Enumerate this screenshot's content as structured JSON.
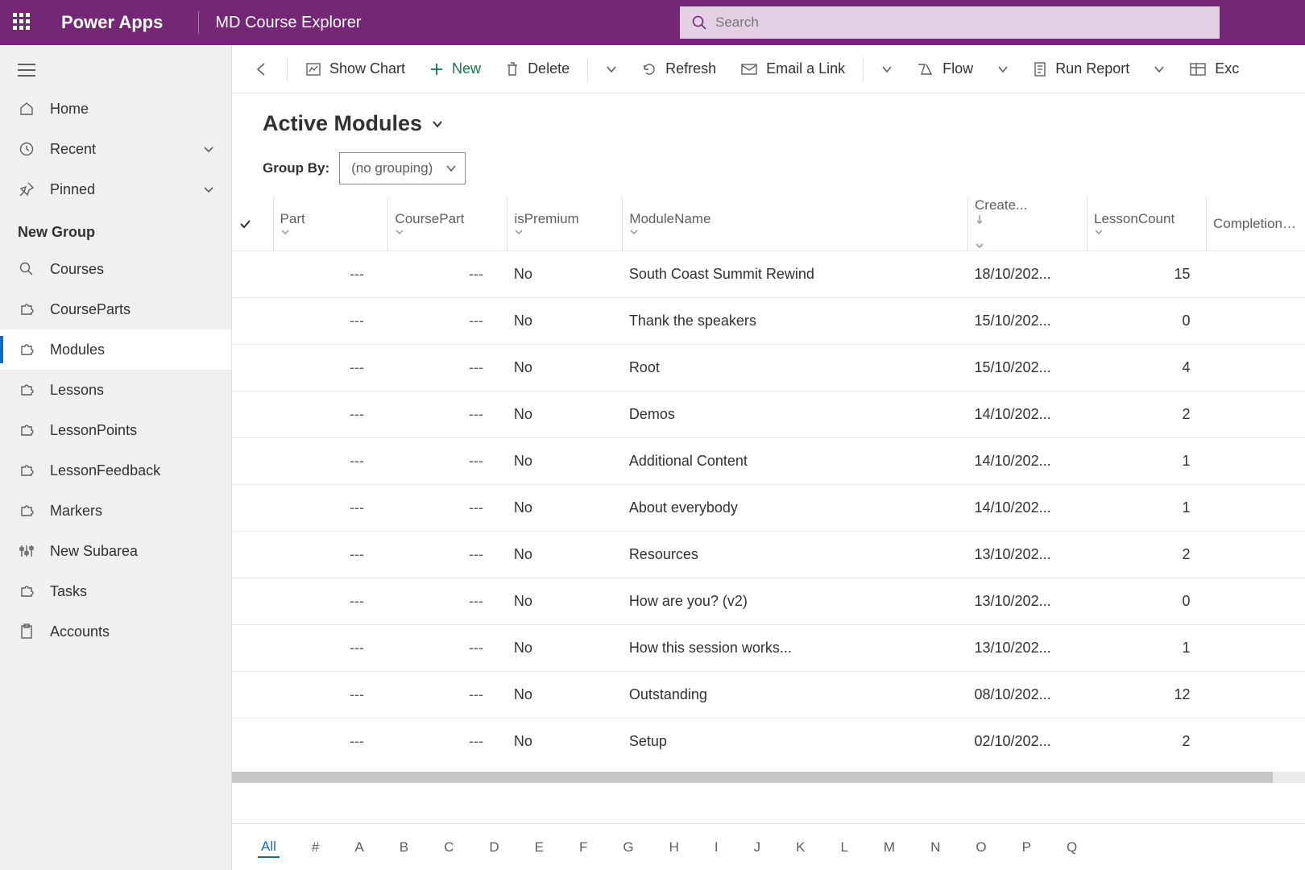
{
  "header": {
    "brand": "Power Apps",
    "app_name": "MD Course Explorer",
    "search_placeholder": "Search"
  },
  "sidebar": {
    "top": [
      {
        "label": "Home"
      },
      {
        "label": "Recent"
      },
      {
        "label": "Pinned"
      }
    ],
    "group_label": "New Group",
    "items": [
      {
        "label": "Courses"
      },
      {
        "label": "CourseParts"
      },
      {
        "label": "Modules"
      },
      {
        "label": "Lessons"
      },
      {
        "label": "LessonPoints"
      },
      {
        "label": "LessonFeedback"
      },
      {
        "label": "Markers"
      },
      {
        "label": "New Subarea"
      },
      {
        "label": "Tasks"
      },
      {
        "label": "Accounts"
      }
    ],
    "active_index": 2
  },
  "commands": {
    "show_chart": "Show Chart",
    "new": "New",
    "delete": "Delete",
    "refresh": "Refresh",
    "email_link": "Email a Link",
    "flow": "Flow",
    "run_report": "Run Report",
    "excel": "Exc"
  },
  "view": {
    "title": "Active Modules",
    "group_by_label": "Group By:",
    "group_by_value": "(no grouping)"
  },
  "grid": {
    "columns": [
      "Part",
      "CoursePart",
      "isPremium",
      "ModuleName",
      "Create...",
      "LessonCount",
      "CompletionPe"
    ],
    "rows": [
      {
        "part": "---",
        "coursepart": "---",
        "ispremium": "No",
        "modulename": "South Coast Summit Rewind",
        "created": "18/10/202...",
        "lessoncount": "15"
      },
      {
        "part": "---",
        "coursepart": "---",
        "ispremium": "No",
        "modulename": "Thank the speakers",
        "created": "15/10/202...",
        "lessoncount": "0"
      },
      {
        "part": "---",
        "coursepart": "---",
        "ispremium": "No",
        "modulename": "Root",
        "created": "15/10/202...",
        "lessoncount": "4"
      },
      {
        "part": "---",
        "coursepart": "---",
        "ispremium": "No",
        "modulename": "Demos",
        "created": "14/10/202...",
        "lessoncount": "2"
      },
      {
        "part": "---",
        "coursepart": "---",
        "ispremium": "No",
        "modulename": "Additional Content",
        "created": "14/10/202...",
        "lessoncount": "1"
      },
      {
        "part": "---",
        "coursepart": "---",
        "ispremium": "No",
        "modulename": "About everybody",
        "created": "14/10/202...",
        "lessoncount": "1"
      },
      {
        "part": "---",
        "coursepart": "---",
        "ispremium": "No",
        "modulename": "Resources",
        "created": "13/10/202...",
        "lessoncount": "2"
      },
      {
        "part": "---",
        "coursepart": "---",
        "ispremium": "No",
        "modulename": "How are you? (v2)",
        "created": "13/10/202...",
        "lessoncount": "0"
      },
      {
        "part": "---",
        "coursepart": "---",
        "ispremium": "No",
        "modulename": "How this session works...",
        "created": "13/10/202...",
        "lessoncount": "1"
      },
      {
        "part": "---",
        "coursepart": "---",
        "ispremium": "No",
        "modulename": "Outstanding",
        "created": "08/10/202...",
        "lessoncount": "12"
      },
      {
        "part": "---",
        "coursepart": "---",
        "ispremium": "No",
        "modulename": "Setup",
        "created": "02/10/202...",
        "lessoncount": "2"
      }
    ]
  },
  "alpha_index": [
    "All",
    "#",
    "A",
    "B",
    "C",
    "D",
    "E",
    "F",
    "G",
    "H",
    "I",
    "J",
    "K",
    "L",
    "M",
    "N",
    "O",
    "P",
    "Q"
  ],
  "alpha_selected": 0
}
